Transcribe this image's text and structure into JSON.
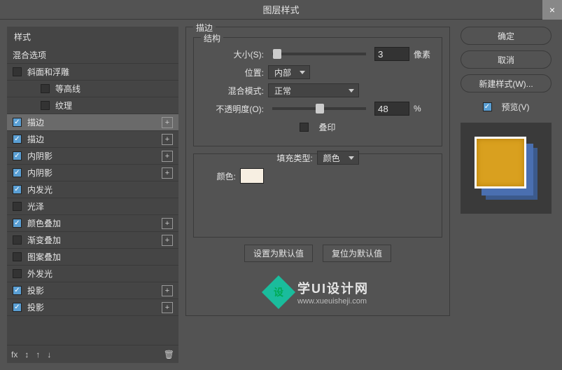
{
  "title": "图层样式",
  "close": "×",
  "left": {
    "header": "样式",
    "rows": [
      {
        "label": "混合选项",
        "hasCheck": false,
        "checked": false,
        "indent": 0,
        "canAdd": false
      },
      {
        "label": "斜面和浮雕",
        "hasCheck": true,
        "checked": false,
        "indent": 0,
        "canAdd": false
      },
      {
        "label": "等高线",
        "hasCheck": true,
        "checked": false,
        "indent": 2,
        "canAdd": false
      },
      {
        "label": "纹理",
        "hasCheck": true,
        "checked": false,
        "indent": 2,
        "canAdd": false
      },
      {
        "label": "描边",
        "hasCheck": true,
        "checked": true,
        "indent": 0,
        "canAdd": true,
        "selected": true
      },
      {
        "label": "描边",
        "hasCheck": true,
        "checked": true,
        "indent": 0,
        "canAdd": true
      },
      {
        "label": "内阴影",
        "hasCheck": true,
        "checked": true,
        "indent": 0,
        "canAdd": true
      },
      {
        "label": "内阴影",
        "hasCheck": true,
        "checked": true,
        "indent": 0,
        "canAdd": true
      },
      {
        "label": "内发光",
        "hasCheck": true,
        "checked": true,
        "indent": 0,
        "canAdd": false
      },
      {
        "label": "光泽",
        "hasCheck": true,
        "checked": false,
        "indent": 0,
        "canAdd": false
      },
      {
        "label": "颜色叠加",
        "hasCheck": true,
        "checked": true,
        "indent": 0,
        "canAdd": true
      },
      {
        "label": "渐变叠加",
        "hasCheck": true,
        "checked": false,
        "indent": 0,
        "canAdd": true
      },
      {
        "label": "图案叠加",
        "hasCheck": true,
        "checked": false,
        "indent": 0,
        "canAdd": false
      },
      {
        "label": "外发光",
        "hasCheck": true,
        "checked": false,
        "indent": 0,
        "canAdd": false
      },
      {
        "label": "投影",
        "hasCheck": true,
        "checked": true,
        "indent": 0,
        "canAdd": true
      },
      {
        "label": "投影",
        "hasCheck": true,
        "checked": true,
        "indent": 0,
        "canAdd": true
      }
    ],
    "footer": {
      "fx": "fx",
      "arrows": "↕",
      "up": "↑",
      "down": "↓",
      "trash": "🗑"
    }
  },
  "center": {
    "groupTitle": "描边",
    "structTitle": "结构",
    "sizeLabel": "大小(S):",
    "sizeValue": "3",
    "sizeUnit": "像素",
    "positionLabel": "位置:",
    "positionValue": "内部",
    "blendLabel": "混合模式:",
    "blendValue": "正常",
    "opacityLabel": "不透明度(O):",
    "opacityValue": "48",
    "opacityUnit": "%",
    "overprintLabel": "叠印",
    "fillTypeLabel": "填充类型:",
    "fillTypeValue": "颜色",
    "colorLabel": "颜色:",
    "colorValue": "#f7efe2",
    "defaultBtn": "设置为默认值",
    "resetBtn": "复位为默认值",
    "wmTitle": "学UI设计网",
    "wmUrl": "www.xueuisheji.com"
  },
  "right": {
    "ok": "确定",
    "cancel": "取消",
    "newStyle": "新建样式(W)...",
    "previewLabel": "预览(V)"
  }
}
